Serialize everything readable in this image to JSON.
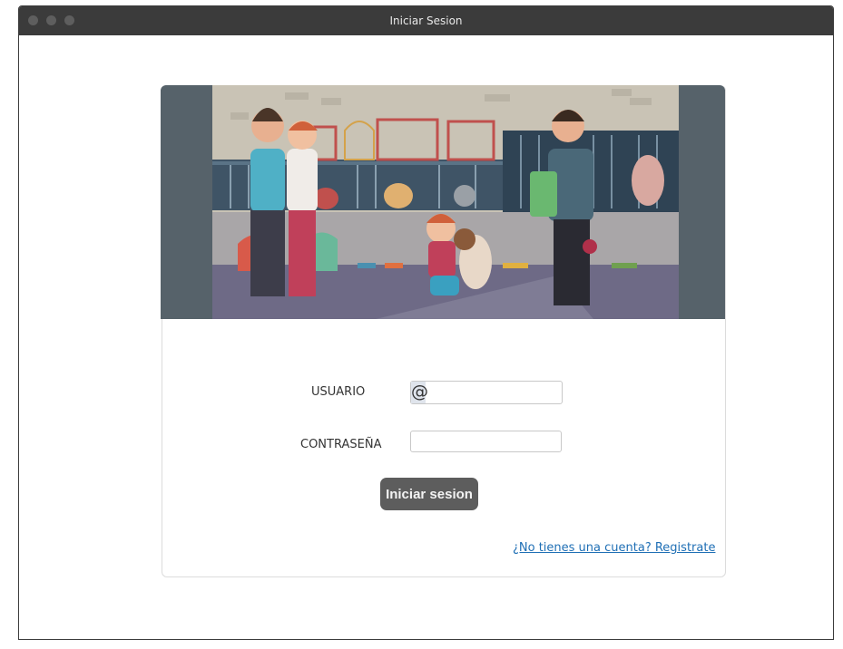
{
  "window": {
    "title": "Iniciar Sesion"
  },
  "login": {
    "user_label": "USUARIO",
    "user_value": "",
    "user_icon": "at-icon",
    "user_icon_glyph": "@",
    "password_label": "CONTRASEÑA",
    "password_value": "",
    "submit_label": "Iniciar sesion",
    "register_link": "¿No tienes una cuenta? Registrate"
  },
  "colors": {
    "titlebar": "#3b3b3b",
    "banner_side": "#56626a",
    "button": "#5d5d5d",
    "link": "#1f6fb5"
  }
}
